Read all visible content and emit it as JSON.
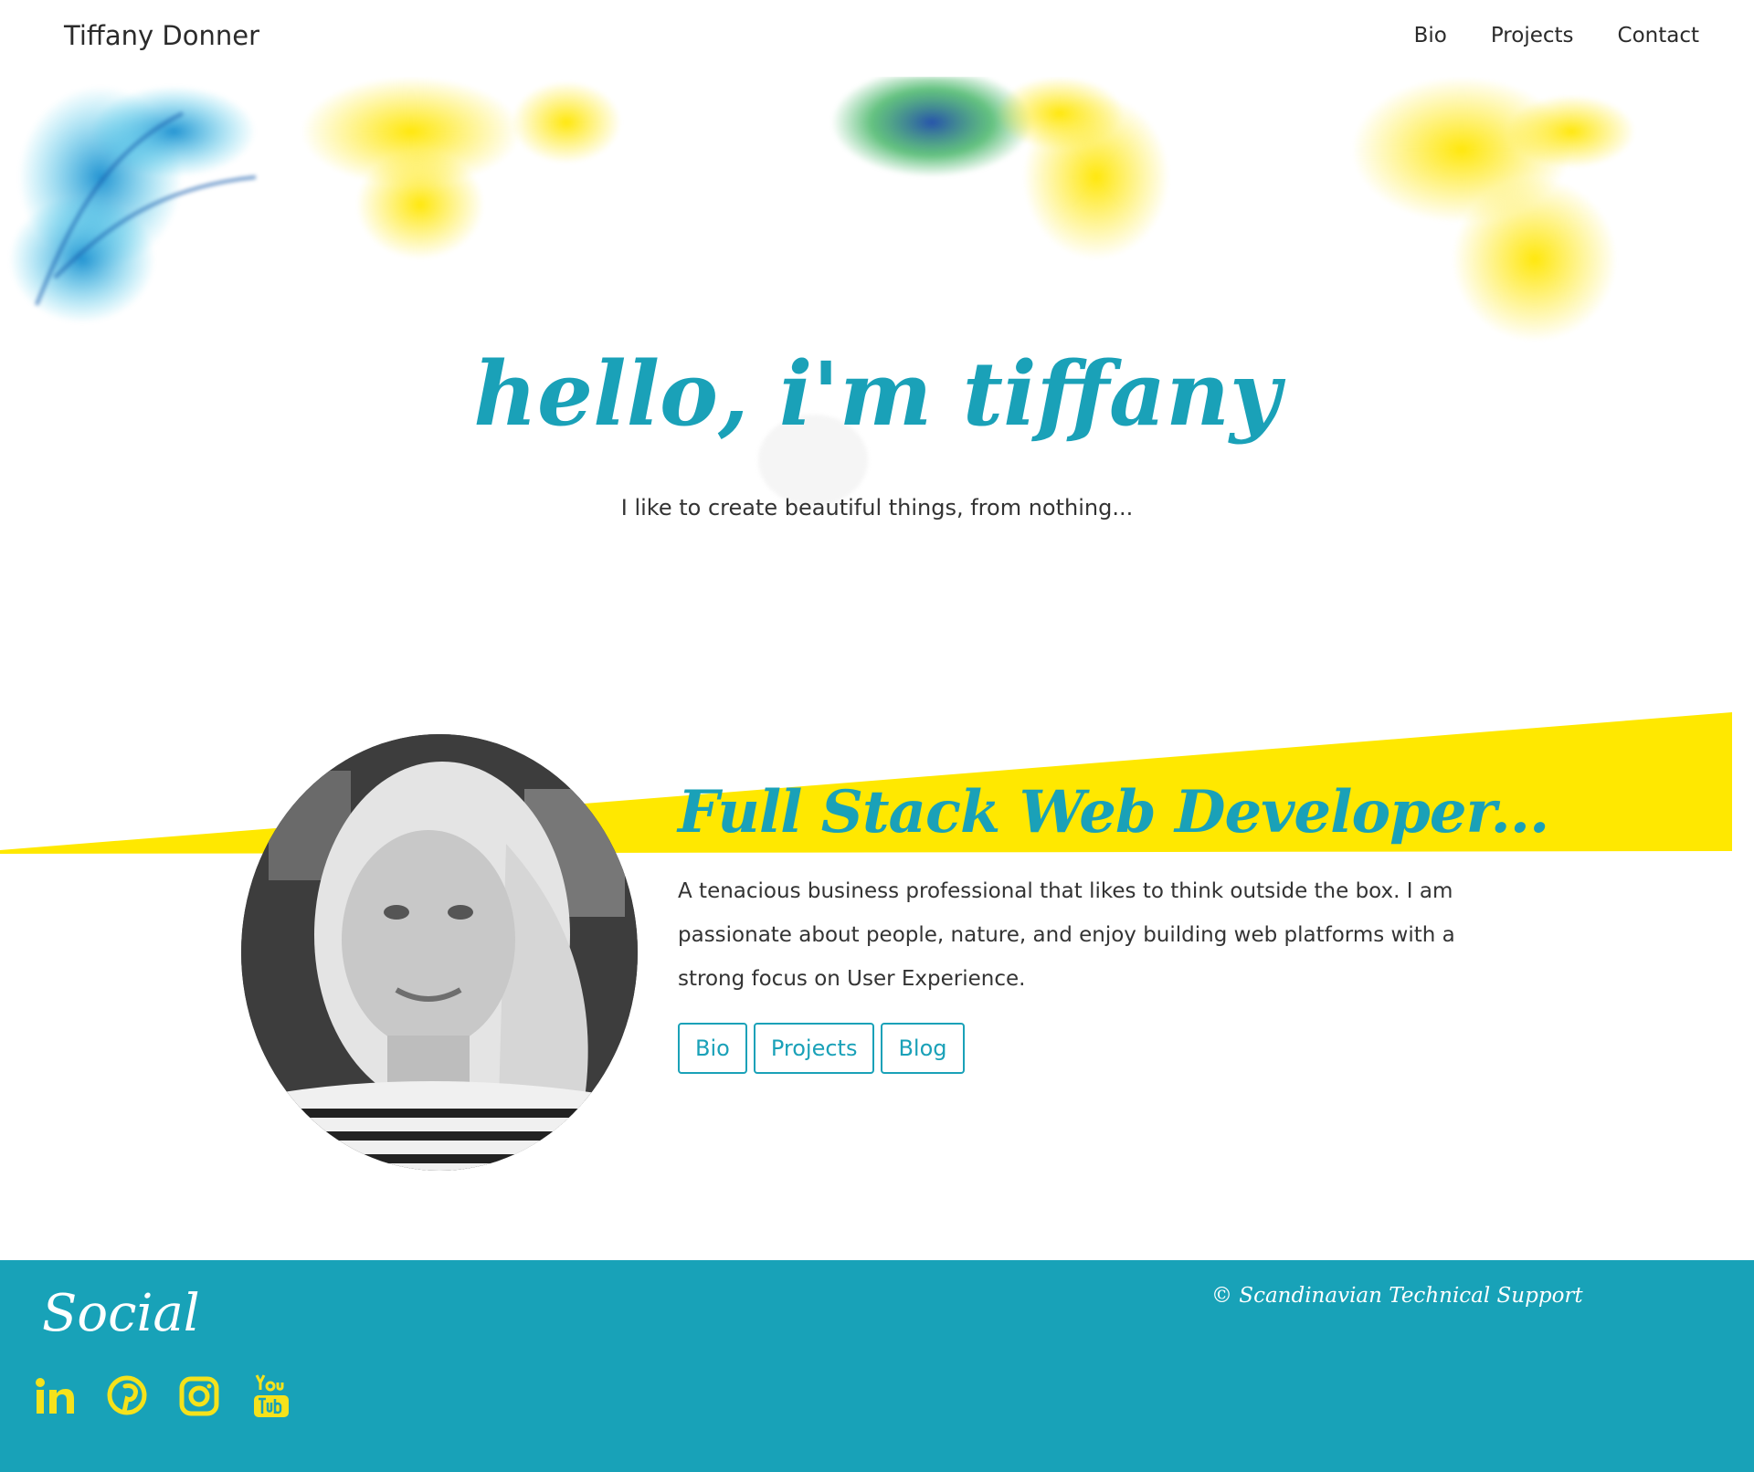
{
  "header": {
    "brand": "Tiffany Donner",
    "nav": [
      {
        "label": "Bio"
      },
      {
        "label": "Projects"
      },
      {
        "label": "Contact"
      }
    ]
  },
  "hero": {
    "title": "hello, i'm tiffany",
    "subtitle": "I like to create beautiful things, from nothing..."
  },
  "about": {
    "title": "Full Stack Web Developer...",
    "text": "A tenacious business professional that likes to think outside the box. I am passionate about people, nature, and enjoy building web platforms with a strong focus on User Experience.",
    "buttons": [
      {
        "label": "Bio"
      },
      {
        "label": "Projects"
      },
      {
        "label": "Blog"
      }
    ]
  },
  "footer": {
    "social_title": "Social",
    "copyright": "© Scandinavian Technical Support",
    "icons": [
      "linkedin-icon",
      "pinterest-icon",
      "instagram-icon",
      "youtube-icon"
    ]
  },
  "colors": {
    "accent": "#1aa1b8",
    "footer_bg": "#18a2b8",
    "yellow": "#ffe800",
    "icon_yellow": "#f5e21b",
    "text": "#333333"
  }
}
